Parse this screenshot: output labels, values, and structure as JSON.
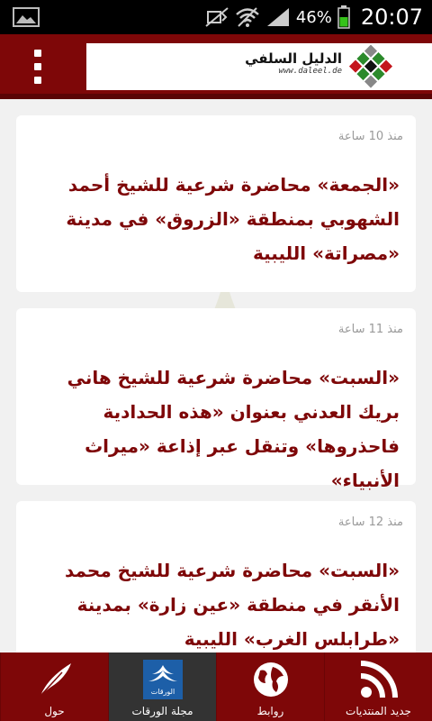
{
  "status_bar": {
    "battery_percent": "46%",
    "time": "20:07",
    "icons": [
      "image-icon",
      "mute-icon",
      "wifi-icon",
      "signal-icon",
      "battery-icon"
    ]
  },
  "header": {
    "logo_arabic": "الدليل السلفي",
    "logo_url": "www.daleel.de"
  },
  "posts": [
    {
      "time": "منذ 10 ساعة",
      "title": "«الجمعة» محاضرة شرعية للشيخ أحمد الشهوبي بمنطقة «الزروق» في مدينة «مصراتة» الليبية"
    },
    {
      "time": "منذ 11 ساعة",
      "title": "«السبت» محاضرة شرعية للشيخ هاني بريك العدني بعنوان «هذه الحدادية فاحذروها» وتنقل عبر إذاعة «ميراث الأنبياء»"
    },
    {
      "time": "منذ 12 ساعة",
      "title": "«السبت» محاضرة شرعية للشيخ محمد الأنقر في منطقة «عين زارة» بمدينة «طرابلس الغرب» الليبية"
    }
  ],
  "bottom_nav": [
    {
      "label": "حول",
      "icon": "quill-icon"
    },
    {
      "label": "مجلة الورقات",
      "icon": "magazine-logo-icon",
      "logo_text": "الورقات",
      "active": true
    },
    {
      "label": "روابط",
      "icon": "globe-icon"
    },
    {
      "label": "جديد المنتديات",
      "icon": "rss-icon"
    }
  ],
  "colors": {
    "brand": "#7e0708",
    "brand_dark": "#5a0405",
    "background": "#f1f1f1",
    "card": "#ffffff",
    "time_text": "#9a9a9a",
    "active_tab": "#333333"
  }
}
